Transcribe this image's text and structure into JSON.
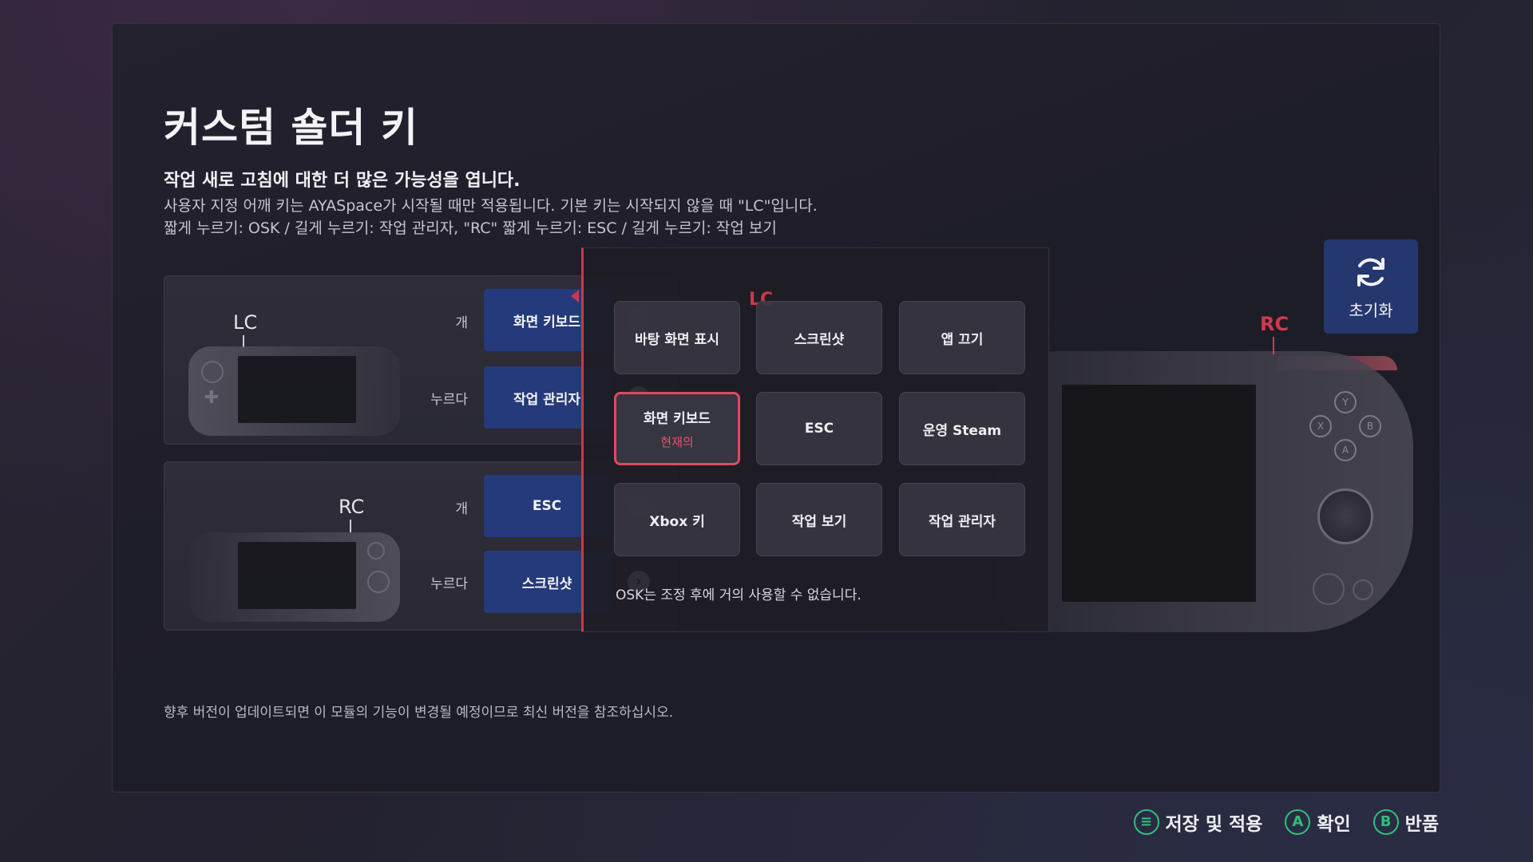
{
  "page": {
    "title": "커스텀 숄더 키",
    "subtitle": "작업 새로 고침에 대한 더 많은 가능성을 엽니다.",
    "desc_line1": "사용자 지정 어깨 키는 AYASpace가 시작될 때만 적용됩니다. 기본 키는 시작되지 않을 때 \"LC\"입니다.",
    "desc_line2": "짧게 누르기: OSK / 길게 누르기: 작업 관리자, \"RC\" 짧게 누르기: ESC / 길게 누르기: 작업 보기",
    "footnote": "향후 버전이 업데이트되면 이 모듈의 기능이 변경될 예정이므로 최신 버전을 참조하십시오."
  },
  "lc_card": {
    "device_label": "LC",
    "row1_label": "개",
    "row1_value": "화면 키보드",
    "row2_label": "누르다",
    "row2_value": "작업 관리자"
  },
  "rc_card": {
    "device_label": "RC",
    "row1_label": "개",
    "row1_value": "ESC",
    "row2_label": "누르다",
    "row2_value": "스크린샷"
  },
  "selector": {
    "options": [
      {
        "label": "바탕 화면 표시"
      },
      {
        "label": "스크린샷"
      },
      {
        "label": "앱 끄기"
      },
      {
        "label": "화면 키보드",
        "sub": "현재의"
      },
      {
        "label": "ESC"
      },
      {
        "label": "운영 Steam"
      },
      {
        "label": "Xbox 키"
      },
      {
        "label": "작업 보기"
      },
      {
        "label": "작업 관리자"
      }
    ],
    "selected_index": 3,
    "note": "OSK는 조정 후에 거의 사용할 수 없습니다.",
    "lc_marker": "LC"
  },
  "big_device": {
    "rc_label": "RC",
    "buttons": [
      "Y",
      "X",
      "B",
      "A"
    ]
  },
  "reset": {
    "label": "초기화"
  },
  "hints": [
    {
      "icon": "≡",
      "label": "저장 및 적용"
    },
    {
      "icon": "A",
      "label": "확인"
    },
    {
      "icon": "B",
      "label": "반품"
    }
  ],
  "colors": {
    "accent_red": "#e04a5f",
    "button_blue": "#243a7a",
    "hint_green": "#2fbf7a"
  }
}
